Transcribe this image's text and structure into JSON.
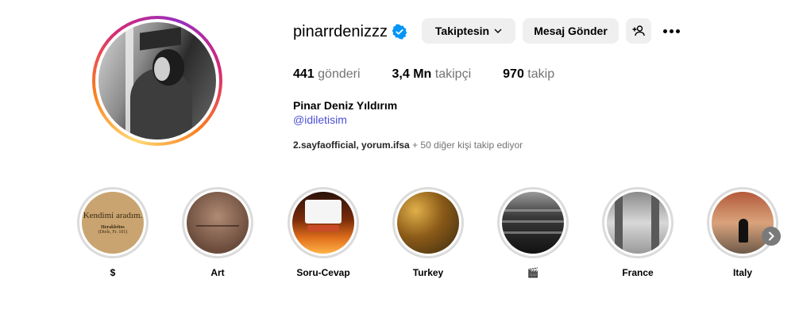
{
  "profile": {
    "username": "pinarrdenizzz",
    "verified": true,
    "full_name": "Pinar Deniz Yıldırım",
    "bio_link": "@idiletisim"
  },
  "actions": {
    "following_label": "Takiptesin",
    "message_label": "Mesaj Gönder",
    "suggest_icon": "person-plus-icon",
    "more_icon": "ellipsis-icon"
  },
  "stats": {
    "posts_value": "441",
    "posts_label": "gönderi",
    "followers_value": "3,4 Mn",
    "followers_label": "takipçi",
    "following_value": "970",
    "following_label": "takip"
  },
  "followed_by": {
    "names": "2.sayfaofficial, yorum.ifsa",
    "more_text": " + 50 diğer kişi takip ediyor"
  },
  "highlight_thumb_1": {
    "line1": "Kendimi aradım.",
    "line2": "Herakleitos",
    "line3": "(Diels, Fr. 101)"
  },
  "highlights": [
    {
      "label": "$",
      "thumb": "book-page"
    },
    {
      "label": "Art",
      "thumb": "brown-paper"
    },
    {
      "label": "Soru-Cevap",
      "thumb": "question-card-fire"
    },
    {
      "label": "Turkey",
      "thumb": "autumn-leaves"
    },
    {
      "label": "🎬",
      "thumb": "film-bw"
    },
    {
      "label": "France",
      "thumb": "arcade-street"
    },
    {
      "label": "Italy",
      "thumb": "red-street"
    }
  ],
  "colors": {
    "verified_blue": "#0095f6",
    "link": "#4c4fd6",
    "button_bg": "#efefef",
    "muted_text": "#737373"
  }
}
